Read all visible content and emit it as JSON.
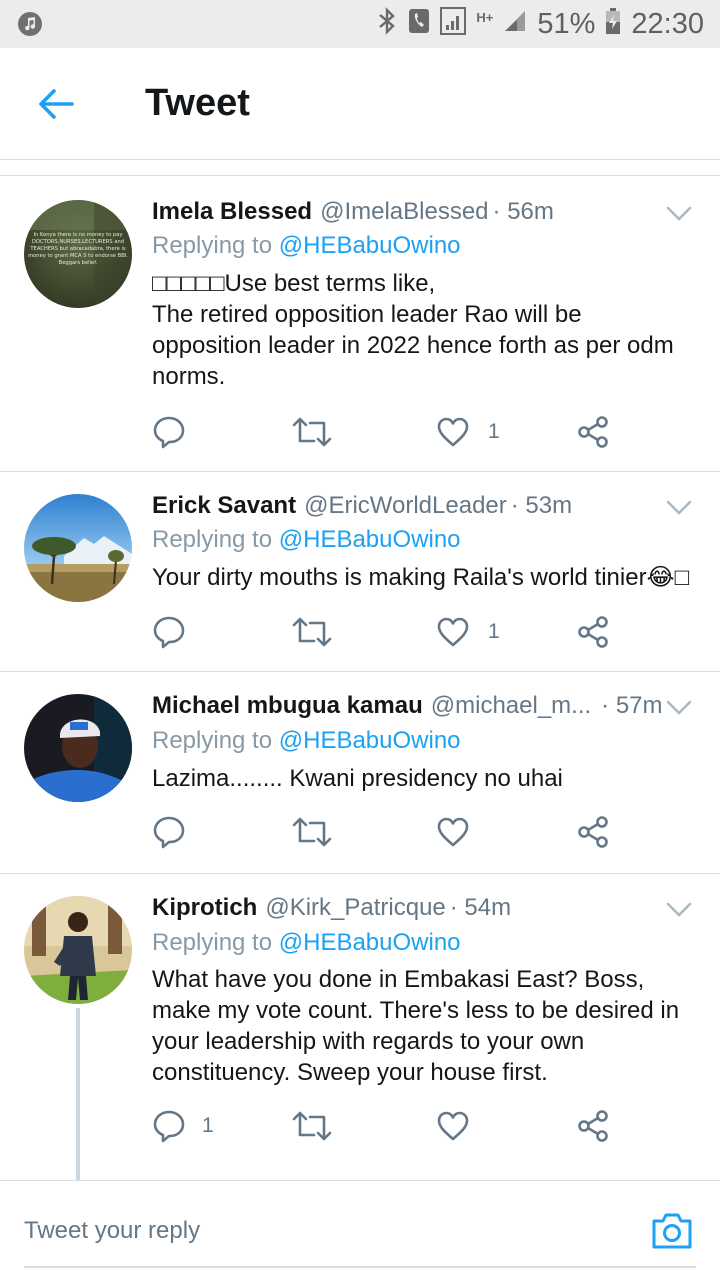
{
  "status_bar": {
    "battery": "51%",
    "time": "22:30",
    "network": "H+"
  },
  "app_bar": {
    "title": "Tweet",
    "back_icon": "arrow-left-icon"
  },
  "colors": {
    "accent": "#1da1f2",
    "secondary_text": "#657786",
    "divider": "#d8dde0"
  },
  "tweets": [
    {
      "name": "Imela Blessed",
      "handle": "@ImelaBlessed",
      "time": "· 56m",
      "replying_prefix": "Replying to",
      "replying_to": "@HEBabuOwino",
      "text": "□□□□□Use best terms like,\nThe retired opposition leader Rao will be opposition leader in 2022 hence forth as per odm norms.",
      "replies": "",
      "retweets": "",
      "likes": "1"
    },
    {
      "name": "Erick Savant",
      "handle": "@EricWorldLeader",
      "time": "· 53m",
      "replying_prefix": "Replying to",
      "replying_to": "@HEBabuOwino",
      "text": "Your dirty mouths is making Raila's world tinier😂□",
      "replies": "",
      "retweets": "",
      "likes": "1"
    },
    {
      "name": "Michael mbugua kamau",
      "handle": "@michael_m...",
      "time": "· 57m",
      "replying_prefix": "Replying to",
      "replying_to": "@HEBabuOwino",
      "text": "Lazima........ Kwani presidency no uhai",
      "replies": "",
      "retweets": "",
      "likes": ""
    },
    {
      "name": "Kiprotich",
      "handle": "@Kirk_Patricque",
      "time": "· 54m",
      "replying_prefix": "Replying to",
      "replying_to": "@HEBabuOwino",
      "text": "What have you done in Embakasi East? Boss, make my vote count. There's less to be desired in your leadership with regards to your own constituency. Sweep your house first.",
      "replies": "1",
      "retweets": "",
      "likes": ""
    }
  ],
  "avatar_caption": "In Kenya there is no money to pay DOCTORS,NURSES,LECTURERS and TEACHERS but abracadabra, there is money to grant MCA S to endorse BBI. Beggars belief.",
  "compose": {
    "placeholder": "Tweet your reply",
    "camera_icon": "camera-icon"
  }
}
